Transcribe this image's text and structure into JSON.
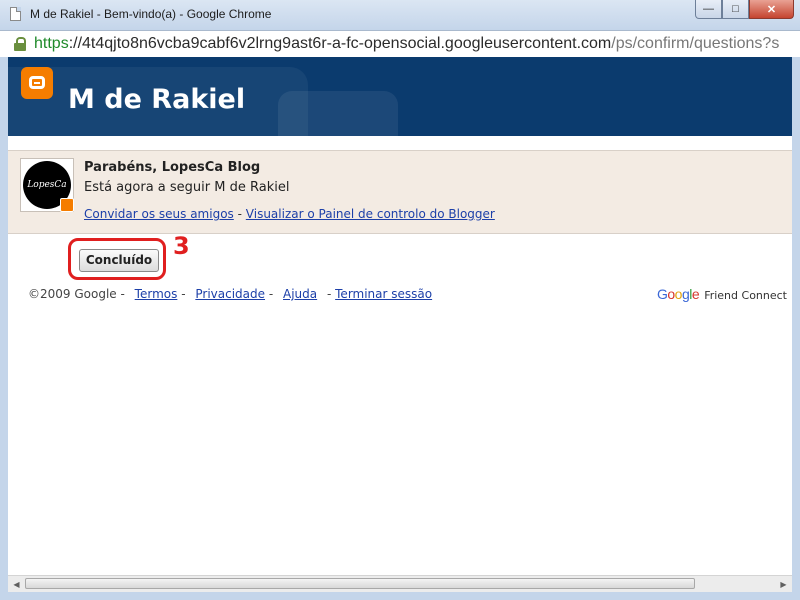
{
  "window": {
    "title": "M de Rakiel - Bem-vindo(a) - Google Chrome",
    "minimize_glyph": "—",
    "maximize_glyph": "□",
    "close_glyph": "✕"
  },
  "address": {
    "scheme": "https",
    "separator": "://",
    "host": "4t4qjto8n6vcba9cabf6v2lrng9ast6r-a-fc-opensocial.googleusercontent.com",
    "path": "/ps/confirm/questions?s"
  },
  "header": {
    "blog_title": "M de Rakiel"
  },
  "confirmation": {
    "congrats": "Parabéns, LopesCa Blog",
    "following": "Está agora a seguir M de Rakiel",
    "avatar_text": "LopesCa",
    "invite_link": "Convidar os seus amigos",
    "separator": "-",
    "dashboard_link": "Visualizar o Painel de controlo do Blogger"
  },
  "actions": {
    "done_label": "Concluído",
    "step_marker": "3"
  },
  "footer": {
    "copyright": "©2009 Google",
    "terms": "Termos",
    "privacy": "Privacidade",
    "help": "Ajuda",
    "signout": "Terminar sessão",
    "separator": "-",
    "google_logo": [
      "G",
      "o",
      "o",
      "g",
      "l",
      "e"
    ],
    "friend_connect": "Friend Connect"
  },
  "colors": {
    "header_bg": "#0b3b6e",
    "panel_bg": "#f3ebe3",
    "link": "#1c3fa8",
    "annotation": "#e01f1f",
    "blogger_orange": "#f57d00"
  },
  "icons": [
    "page-icon",
    "lock-icon",
    "blogger-logo-icon",
    "blogger-badge-icon",
    "scroll-left-icon",
    "scroll-right-icon"
  ]
}
